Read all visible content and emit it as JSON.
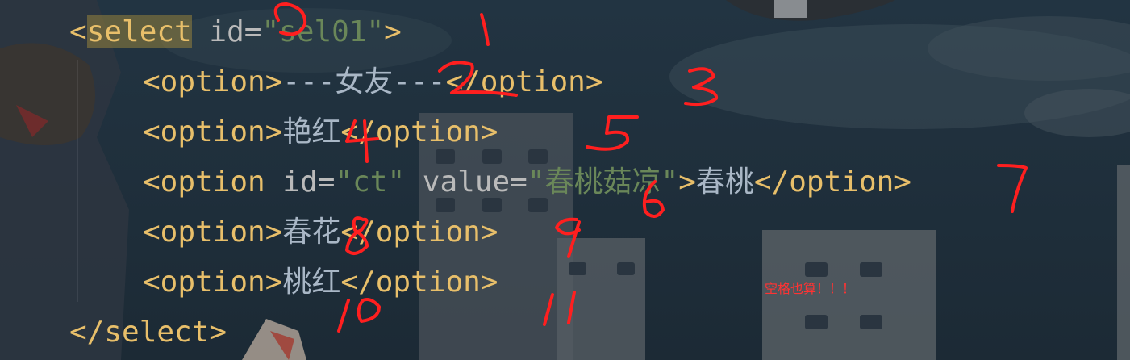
{
  "code": {
    "line1": {
      "open": "<",
      "name": "select",
      "attr": " id=",
      "value": "\"sel01\"",
      "close": ">"
    },
    "line2": {
      "open": "<option>",
      "text": "---女友---",
      "close": "</option>"
    },
    "line3": {
      "open": "<option>",
      "text": "艳红",
      "close": "</option>"
    },
    "line4": {
      "open": "<option",
      "attr1": " id=",
      "val1": "\"ct\"",
      "attr2": " value=",
      "val2": "\"春桃菇凉\"",
      "gt": ">",
      "text": "春桃",
      "close": "</option>"
    },
    "line5": {
      "open": "<option>",
      "text": "春花",
      "close": "</option>"
    },
    "line6": {
      "open": "<option>",
      "text": "桃红",
      "close": "</option>"
    },
    "line7": {
      "close": "</select>"
    }
  },
  "annotations": {
    "note": "空格也算！！！"
  },
  "colors": {
    "tag": "#e8bf6a",
    "attribute": "#bababa",
    "string": "#6a8759",
    "text": "#a9b7c6",
    "annotation": "#ff2a2a"
  }
}
